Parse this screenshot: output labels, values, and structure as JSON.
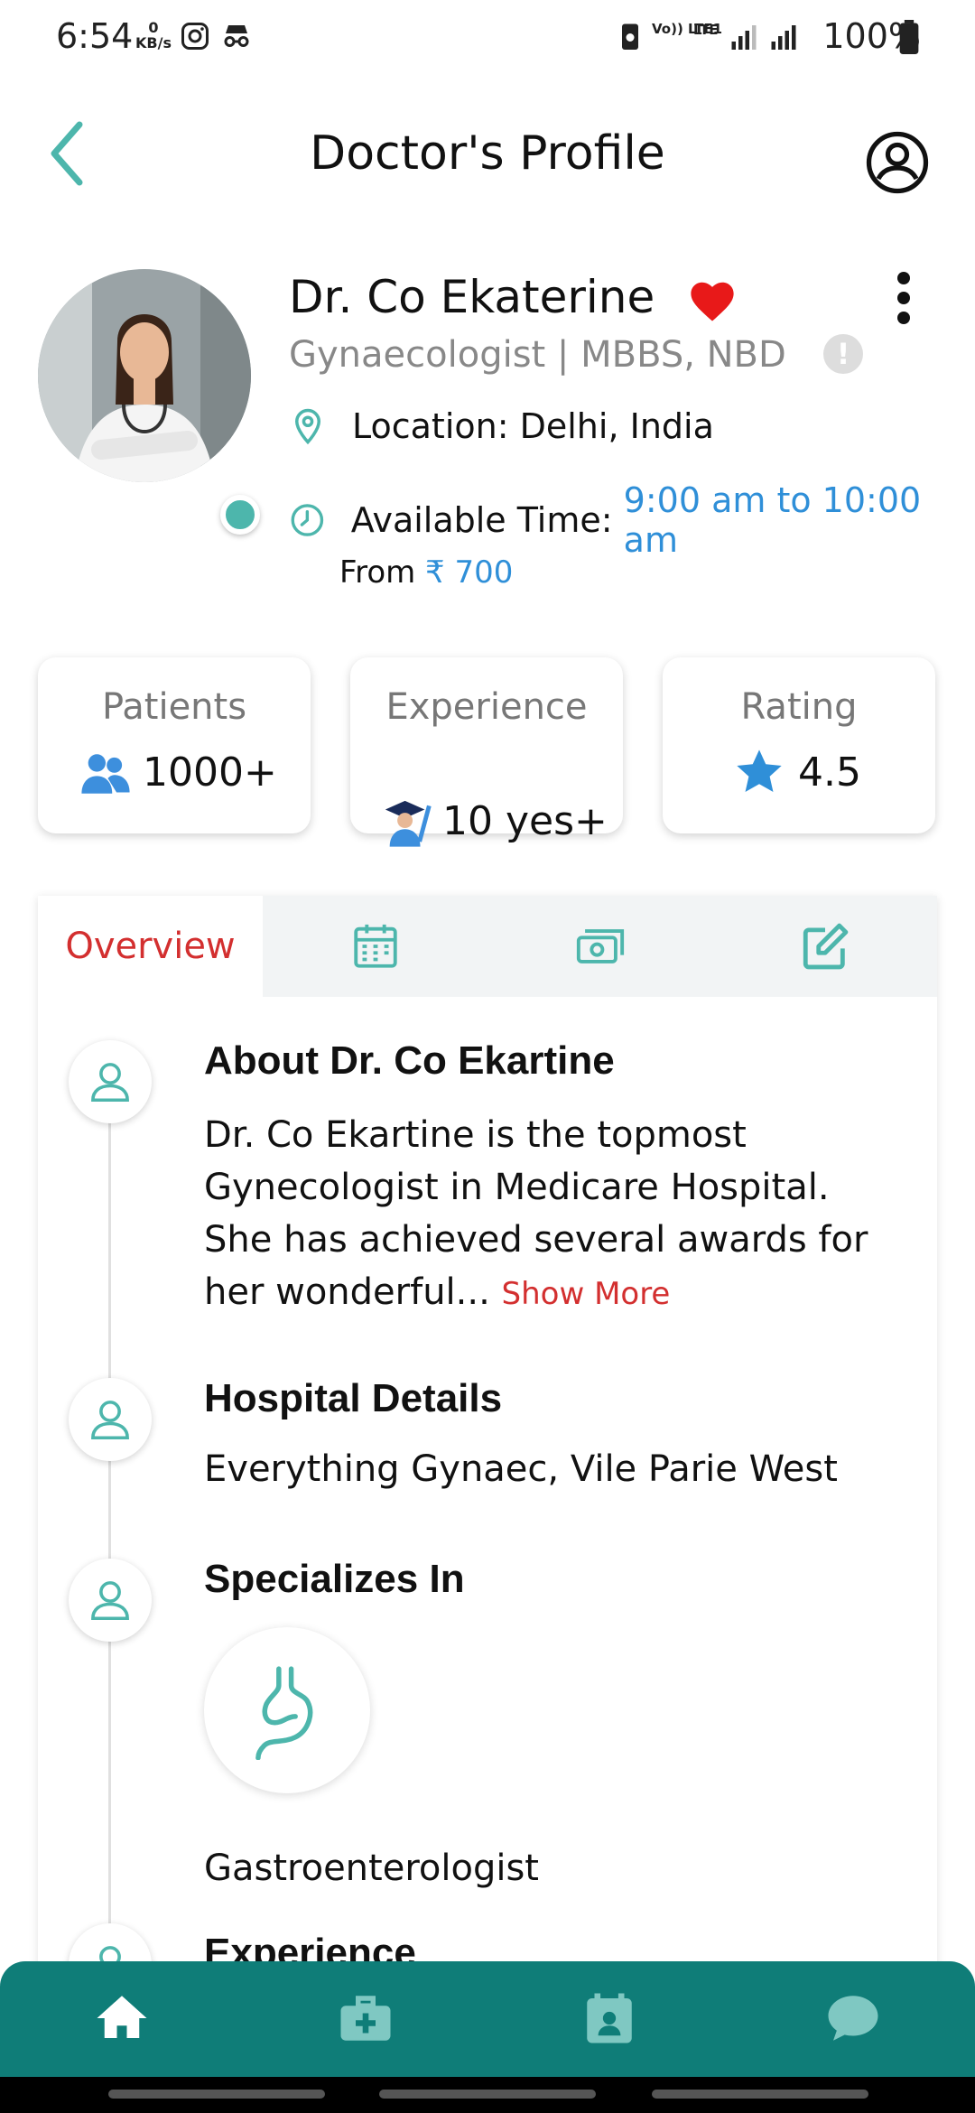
{
  "status_bar": {
    "time": "6:54",
    "net_speed_value": "0",
    "net_speed_unit": "KB/s",
    "network_label_1": "Vo)) LTE1",
    "network_label_2": "LTE",
    "battery": "100%"
  },
  "header": {
    "title": "Doctor's Profile"
  },
  "doctor": {
    "name": "Dr. Co Ekaterine",
    "specialty": "Gynaecologist | MBBS, NBD",
    "location_label": "Location: ",
    "location_value": "Delhi, India",
    "time_label": "Available Time: ",
    "time_value": "9:00 am to 10:00 am",
    "fee_label": "From ",
    "fee_value": "₹ 700"
  },
  "stats": {
    "patients_label": "Patients",
    "patients_value": "1000+",
    "experience_label": "Experience",
    "experience_value": "10 yes+",
    "rating_label": "Rating",
    "rating_value": "4.5"
  },
  "tabs": {
    "overview_label": "Overview"
  },
  "sections": {
    "about_title": "About Dr. Co Ekartine",
    "about_text": "Dr. Co Ekartine is the topmost Gynecologist in Medicare Hospital. She has achieved several awards for her wonderful...",
    "show_more": "Show More",
    "hospital_title": "Hospital Details",
    "hospital_text": "Everything Gynaec, Vile Parie West",
    "specializes_title": "Specializes In",
    "specialization": "Gastroenterologist",
    "experience_title": "Experience"
  },
  "colors": {
    "teal": "#4db6ac",
    "nav_bg": "#0f7d78",
    "accent_red": "#d32f2f",
    "link_blue": "#2f8fd8"
  },
  "icons": {
    "back": "chevron-left-icon",
    "account": "account-circle-icon",
    "favorite": "heart-icon",
    "menu": "more-vert-icon",
    "info": "info-icon",
    "location": "location-pin-icon",
    "time": "clock-icon",
    "patients": "people-icon",
    "experience": "graduate-icon",
    "rating": "star-icon",
    "nav": [
      "home-icon",
      "medkit-icon",
      "calendar-icon",
      "chat-icon"
    ]
  }
}
